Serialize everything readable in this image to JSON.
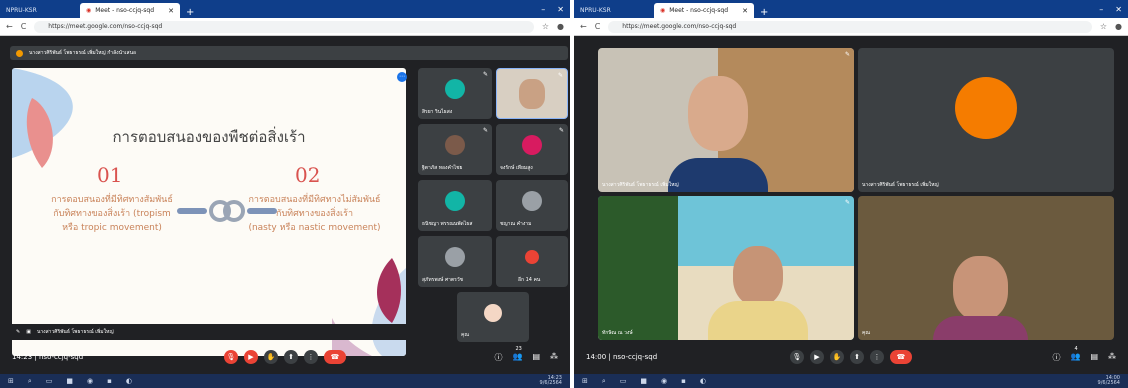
{
  "left": {
    "tab1": "NPRU-KSR",
    "tab2": "Meet - nso-ccjq-sqd",
    "url": "https://meet.google.com/nso-ccjq-sqd",
    "banner": "นางสาวศิริพันธ์ โพธาธรณ์ เพิ่มใหญ่ กำลังนำเสนอ",
    "slide": {
      "title": "การตอบสนองของพืชต่อสิ่งเร้า",
      "num1": "01",
      "num2": "02",
      "text1_l1": "การตอบสนองที่มีทิศทางสัมพันธ์",
      "text1_l2": "กับทิศทางของสิ่งเร้า (tropism",
      "text1_l3": "หรือ tropic movement)",
      "text2_l1": "การตอบสนองที่มีทิศทางไม่สัมพันธ์",
      "text2_l2": "กับทิศทางของสิ่งเร้า",
      "text2_l3": "(nasty หรือ nastic movement)"
    },
    "presenter": "นางสาวศิริพันธ์ โพธาธรณ์ เพิ่มใหญ่",
    "tiles": [
      "สิรยา รินไธสง",
      "",
      "ฐิตาภัส ทองคำไชย",
      "จงรักษ์ เทียมสูง",
      "ธนิชญา พรรณนพัดไธส",
      "ชญาณ คำงาม",
      "สุภัทรพงษ์ ศาตรวัช",
      "อีก 14 คน",
      "คุณ"
    ],
    "more_badge": "23",
    "time": "14:23",
    "code": "nso-ccjq-sqd",
    "tray_time": "14:23",
    "tray_date": "9/6/2564"
  },
  "right": {
    "tab1": "NPRU-KSR",
    "tab2": "Meet - nso-ccjq-sqd",
    "url": "https://meet.google.com/nso-ccjq-sqd",
    "tiles": [
      "นางสาวศิริพันธ์ โพธาธรณ์ เพิ่มใหญ่",
      "นางสาวศิริพันธ์ โพธาธรณ์ เพิ่มใหญ่",
      "ทักษิณ ณ วงษ์",
      "คุณ"
    ],
    "badge": "4",
    "time": "14:00",
    "code": "nso-ccjq-sqd",
    "tray_time": "14:00",
    "tray_date": "9/6/2564"
  }
}
